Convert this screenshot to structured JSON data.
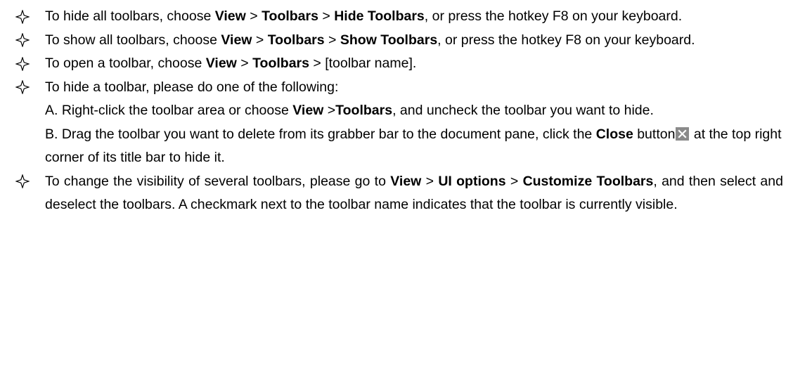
{
  "colors": {
    "text": "#000000",
    "close_button_bg": "#8a8a8a",
    "close_button_x": "#ffffff"
  },
  "icons": {
    "bullet": "diamond-star-outline-icon",
    "close_button": "close-x-icon"
  },
  "list": {
    "item1": {
      "pre": "To hide all toolbars, choose ",
      "view": "View",
      "sep1": " > ",
      "toolbars": "Toolbars",
      "sep2": " > ",
      "target": "Hide Toolbars",
      "post": ", or press the hotkey F8 on your keyboard."
    },
    "item2": {
      "pre": "To show all toolbars, choose ",
      "view": "View",
      "sep1": " > ",
      "toolbars": "Toolbars",
      "sep2": " > ",
      "target": "Show Toolbars",
      "post": ", or press the hotkey F8 on your keyboard."
    },
    "item3": {
      "pre": "To open a toolbar, choose ",
      "view": "View",
      "sep1": " > ",
      "toolbars": "Toolbars",
      "post": " > [toolbar name]."
    },
    "item4": {
      "intro": "To hide a toolbar, please do one of the following:",
      "a_pre": "A. Right-click the toolbar area or choose ",
      "a_view": "View",
      "a_sep": " >",
      "a_toolbars": "Toolbars",
      "a_post": ", and uncheck the toolbar you want to hide.",
      "b_pre": "B. Drag the toolbar you want to delete from its grabber bar to the document pane, click the ",
      "b_close": "Close",
      "b_mid": " button",
      "b_post": " at the top right corner of its title bar to hide it."
    },
    "item5": {
      "pre": "To change the visibility of several toolbars, please go to ",
      "view": "View",
      "sep1": " > ",
      "ui_options": "UI options",
      "sep2": " > ",
      "customize": "Customize Toolbars",
      "post": ", and then select and deselect the toolbars. A checkmark next to the toolbar name indicates that the toolbar is currently visible."
    }
  }
}
